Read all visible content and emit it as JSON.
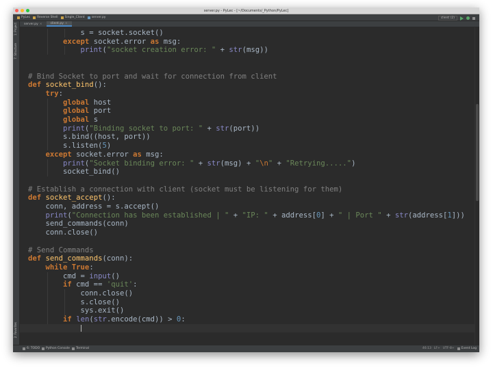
{
  "window": {
    "title": "server.py - PyLec - [~/Documents/_Python/PyLec]"
  },
  "navbar": {
    "crumbs": [
      "PyLec",
      "Reverse Shell",
      "Single_Client",
      "server.py"
    ],
    "run_config": "client (2)"
  },
  "tool_windows": {
    "project": "1: Project",
    "structure": "7: Structure",
    "favorites": "2: Favorites"
  },
  "tabs": [
    {
      "label": "server.py",
      "active": true
    },
    {
      "label": "client.py",
      "active": false
    }
  ],
  "code_lines": [
    {
      "indent": 3,
      "tokens": [
        {
          "t": "s = socket.socket()",
          "c": "#a9b7c6"
        }
      ]
    },
    {
      "indent": 2,
      "tokens": [
        {
          "t": "except",
          "c": "#cc7832",
          "b": true
        },
        {
          "t": " socket.error ",
          "c": "#a9b7c6"
        },
        {
          "t": "as",
          "c": "#cc7832",
          "b": true
        },
        {
          "t": " msg:",
          "c": "#a9b7c6"
        }
      ]
    },
    {
      "indent": 3,
      "tokens": [
        {
          "t": "print",
          "c": "#8888c6"
        },
        {
          "t": "(",
          "c": "#a9b7c6"
        },
        {
          "t": "\"socket creation error: \"",
          "c": "#6a8759"
        },
        {
          "t": " + ",
          "c": "#a9b7c6"
        },
        {
          "t": "str",
          "c": "#8888c6"
        },
        {
          "t": "(msg))",
          "c": "#a9b7c6"
        }
      ]
    },
    {
      "indent": 0,
      "tokens": []
    },
    {
      "indent": 0,
      "tokens": []
    },
    {
      "indent": 0,
      "tokens": [
        {
          "t": "# Bind Socket to port and wait for connection from client",
          "c": "#808080"
        }
      ]
    },
    {
      "indent": 0,
      "tokens": [
        {
          "t": "def",
          "c": "#cc7832",
          "b": true
        },
        {
          "t": " ",
          "c": "#a9b7c6"
        },
        {
          "t": "socket_bind",
          "c": "#ffc66d"
        },
        {
          "t": "():",
          "c": "#a9b7c6"
        }
      ]
    },
    {
      "indent": 1,
      "tokens": [
        {
          "t": "try",
          "c": "#cc7832",
          "b": true
        },
        {
          "t": ":",
          "c": "#a9b7c6"
        }
      ]
    },
    {
      "indent": 2,
      "tokens": [
        {
          "t": "global",
          "c": "#cc7832",
          "b": true
        },
        {
          "t": " host",
          "c": "#a9b7c6"
        }
      ]
    },
    {
      "indent": 2,
      "tokens": [
        {
          "t": "global",
          "c": "#cc7832",
          "b": true
        },
        {
          "t": " port",
          "c": "#a9b7c6"
        }
      ]
    },
    {
      "indent": 2,
      "tokens": [
        {
          "t": "global",
          "c": "#cc7832",
          "b": true
        },
        {
          "t": " s",
          "c": "#a9b7c6"
        }
      ]
    },
    {
      "indent": 2,
      "tokens": [
        {
          "t": "print",
          "c": "#8888c6"
        },
        {
          "t": "(",
          "c": "#a9b7c6"
        },
        {
          "t": "\"Binding socket to port: \"",
          "c": "#6a8759"
        },
        {
          "t": " + ",
          "c": "#a9b7c6"
        },
        {
          "t": "str",
          "c": "#8888c6"
        },
        {
          "t": "(port))",
          "c": "#a9b7c6"
        }
      ]
    },
    {
      "indent": 2,
      "tokens": [
        {
          "t": "s.bind((host, port))",
          "c": "#a9b7c6"
        }
      ]
    },
    {
      "indent": 2,
      "tokens": [
        {
          "t": "s.listen(",
          "c": "#a9b7c6"
        },
        {
          "t": "5",
          "c": "#6897bb"
        },
        {
          "t": ")",
          "c": "#a9b7c6"
        }
      ]
    },
    {
      "indent": 1,
      "tokens": [
        {
          "t": "except",
          "c": "#cc7832",
          "b": true
        },
        {
          "t": " socket.error ",
          "c": "#a9b7c6"
        },
        {
          "t": "as",
          "c": "#cc7832",
          "b": true
        },
        {
          "t": " msg:",
          "c": "#a9b7c6"
        }
      ]
    },
    {
      "indent": 2,
      "tokens": [
        {
          "t": "print",
          "c": "#8888c6"
        },
        {
          "t": "(",
          "c": "#a9b7c6"
        },
        {
          "t": "\"Socket binding error: \"",
          "c": "#6a8759"
        },
        {
          "t": " + ",
          "c": "#a9b7c6"
        },
        {
          "t": "str",
          "c": "#8888c6"
        },
        {
          "t": "(msg) + ",
          "c": "#a9b7c6"
        },
        {
          "t": "\"",
          "c": "#6a8759"
        },
        {
          "t": "\\n",
          "c": "#cc7832"
        },
        {
          "t": "\"",
          "c": "#6a8759"
        },
        {
          "t": " + ",
          "c": "#a9b7c6"
        },
        {
          "t": "\"Retrying.....\"",
          "c": "#6a8759"
        },
        {
          "t": ")",
          "c": "#a9b7c6"
        }
      ]
    },
    {
      "indent": 2,
      "tokens": [
        {
          "t": "socket_bind()",
          "c": "#a9b7c6"
        }
      ]
    },
    {
      "indent": 0,
      "tokens": []
    },
    {
      "indent": 0,
      "tokens": [
        {
          "t": "# Establish a connection with client (socket must be listening for them)",
          "c": "#808080"
        }
      ]
    },
    {
      "indent": 0,
      "tokens": [
        {
          "t": "def",
          "c": "#cc7832",
          "b": true
        },
        {
          "t": " ",
          "c": "#a9b7c6"
        },
        {
          "t": "socket_accept",
          "c": "#ffc66d"
        },
        {
          "t": "():",
          "c": "#a9b7c6"
        }
      ]
    },
    {
      "indent": 1,
      "tokens": [
        {
          "t": "conn, address = s.accept()",
          "c": "#a9b7c6"
        }
      ]
    },
    {
      "indent": 1,
      "tokens": [
        {
          "t": "print",
          "c": "#8888c6"
        },
        {
          "t": "(",
          "c": "#a9b7c6"
        },
        {
          "t": "\"Connection has been established | \"",
          "c": "#6a8759"
        },
        {
          "t": " + ",
          "c": "#a9b7c6"
        },
        {
          "t": "\"IP: \"",
          "c": "#6a8759"
        },
        {
          "t": " + address[",
          "c": "#a9b7c6"
        },
        {
          "t": "0",
          "c": "#6897bb"
        },
        {
          "t": "] + ",
          "c": "#a9b7c6"
        },
        {
          "t": "\" | Port \"",
          "c": "#6a8759"
        },
        {
          "t": " + ",
          "c": "#a9b7c6"
        },
        {
          "t": "str",
          "c": "#8888c6"
        },
        {
          "t": "(address[",
          "c": "#a9b7c6"
        },
        {
          "t": "1",
          "c": "#6897bb"
        },
        {
          "t": "]))",
          "c": "#a9b7c6"
        }
      ]
    },
    {
      "indent": 1,
      "tokens": [
        {
          "t": "send_commands(conn)",
          "c": "#a9b7c6"
        }
      ]
    },
    {
      "indent": 1,
      "tokens": [
        {
          "t": "conn.close()",
          "c": "#a9b7c6"
        }
      ]
    },
    {
      "indent": 0,
      "tokens": []
    },
    {
      "indent": 0,
      "tokens": [
        {
          "t": "# Send Commands",
          "c": "#808080"
        }
      ]
    },
    {
      "indent": 0,
      "tokens": [
        {
          "t": "def",
          "c": "#cc7832",
          "b": true
        },
        {
          "t": " ",
          "c": "#a9b7c6"
        },
        {
          "t": "send_commands",
          "c": "#ffc66d"
        },
        {
          "t": "(conn):",
          "c": "#a9b7c6"
        }
      ]
    },
    {
      "indent": 1,
      "tokens": [
        {
          "t": "while",
          "c": "#cc7832",
          "b": true
        },
        {
          "t": " ",
          "c": "#a9b7c6"
        },
        {
          "t": "True",
          "c": "#cc7832",
          "b": true
        },
        {
          "t": ":",
          "c": "#a9b7c6"
        }
      ]
    },
    {
      "indent": 2,
      "tokens": [
        {
          "t": "cmd = ",
          "c": "#a9b7c6"
        },
        {
          "t": "input",
          "c": "#8888c6"
        },
        {
          "t": "()",
          "c": "#a9b7c6"
        }
      ]
    },
    {
      "indent": 2,
      "tokens": [
        {
          "t": "if",
          "c": "#cc7832",
          "b": true
        },
        {
          "t": " cmd == ",
          "c": "#a9b7c6"
        },
        {
          "t": "'quit'",
          "c": "#6a8759"
        },
        {
          "t": ":",
          "c": "#a9b7c6"
        }
      ]
    },
    {
      "indent": 3,
      "tokens": [
        {
          "t": "conn.close()",
          "c": "#a9b7c6"
        }
      ]
    },
    {
      "indent": 3,
      "tokens": [
        {
          "t": "s.close()",
          "c": "#a9b7c6"
        }
      ]
    },
    {
      "indent": 3,
      "tokens": [
        {
          "t": "sys.exit()",
          "c": "#a9b7c6"
        }
      ]
    },
    {
      "indent": 2,
      "tokens": [
        {
          "t": "if",
          "c": "#cc7832",
          "b": true
        },
        {
          "t": " ",
          "c": "#a9b7c6"
        },
        {
          "t": "len",
          "c": "#8888c6"
        },
        {
          "t": "(",
          "c": "#a9b7c6"
        },
        {
          "t": "str",
          "c": "#8888c6"
        },
        {
          "t": ".encode(cmd)) > ",
          "c": "#a9b7c6"
        },
        {
          "t": "0",
          "c": "#6897bb"
        },
        {
          "t": ":",
          "c": "#a9b7c6"
        }
      ]
    },
    {
      "indent": 0,
      "tokens": [],
      "caret_indent": 3
    }
  ],
  "bottom_tools": [
    "6: TODO",
    "Python Console",
    "Terminal"
  ],
  "event_log": "Event Log",
  "status": {
    "position": "46:13",
    "line_sep": "LF÷",
    "encoding": "UTF-8÷"
  }
}
